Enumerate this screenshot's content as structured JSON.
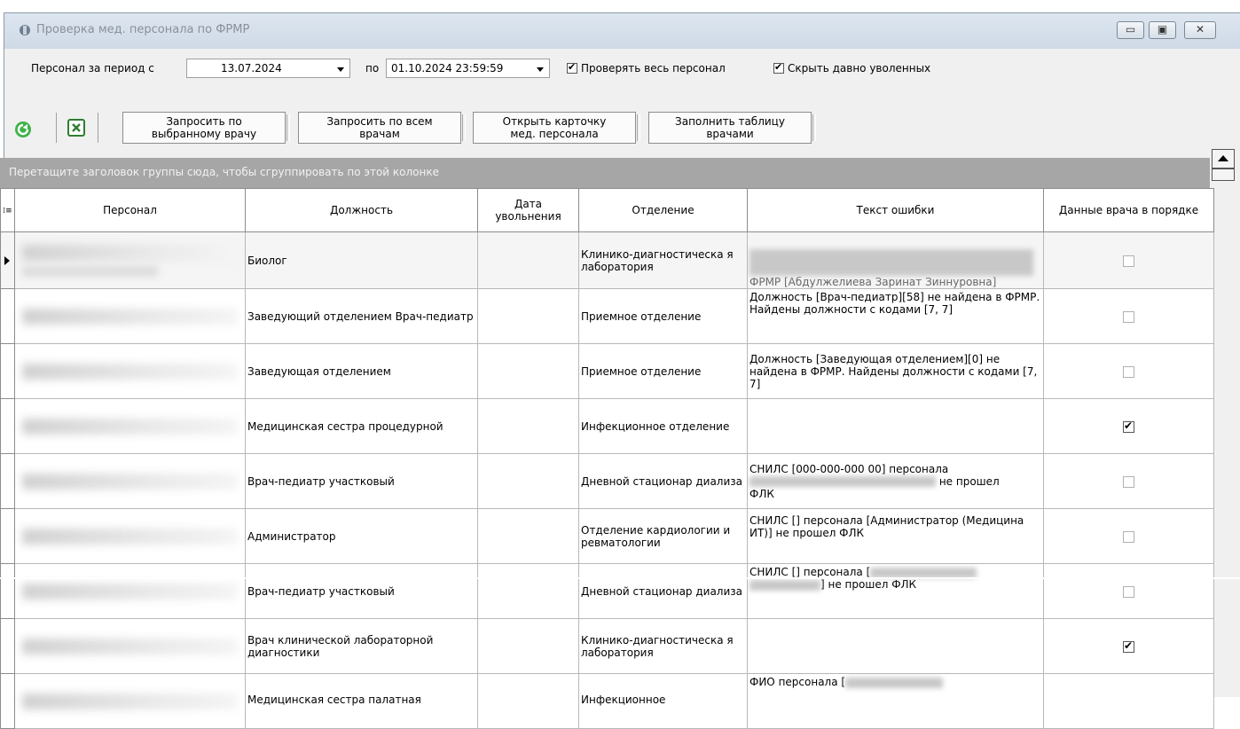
{
  "window": {
    "title": "Проверка мед. персонала по ФРМР"
  },
  "filter": {
    "period_label": "Персонал за период с",
    "date_from": "13.07.2024",
    "to_label": "по",
    "date_to": "01.10.2024 23:59:59",
    "check_all_label": "Проверять весь персонал",
    "check_all": true,
    "hide_fired_label": "Скрыть давно уволенных",
    "hide_fired": true
  },
  "toolbar": {
    "refresh_icon": "refresh-icon",
    "excel_icon": "excel-icon",
    "btn_query_selected": [
      "Запросить по",
      "выбранному врачу"
    ],
    "btn_query_all": [
      "Запросить по всем",
      "врачам"
    ],
    "btn_open_card": [
      "Открыть карточку",
      "мед. персонала"
    ],
    "btn_fill_table": [
      "Заполнить таблицу",
      "врачами"
    ]
  },
  "grid": {
    "group_hint": "Перетащите заголовок группы сюда, чтобы сгруппировать по этой колонке",
    "columns": [
      "Персонал",
      "Должность",
      "Дата увольнения",
      "Отделение",
      "Текст ошибки",
      "Данные врача в порядке"
    ],
    "rows": [
      {
        "position": "Биолог",
        "fired": "",
        "department": "Клинико-диагностическа я лаборатория",
        "error": "ФРМР [Абдулжелиева Заринат Зиннуровна]",
        "ok": false,
        "selected": true
      },
      {
        "position": "Заведующий отделением Врач-педиатр",
        "fired": "",
        "department": "Приемное отделение",
        "error": "Должность [Врач-педиатр][58] не найдена в ФРМР. Найдены должности с кодами [7, 7]",
        "ok": false
      },
      {
        "position": "Заведующая отделением",
        "fired": "",
        "department": "Приемное отделение",
        "error": "Должность [Заведующая отделением][0] не найдена в ФРМР. Найдены должности с кодами [7, 7]",
        "ok": false
      },
      {
        "position": "Медицинская сестра процедурной",
        "fired": "",
        "department": "Инфекционное отделение",
        "error": "",
        "ok": true
      },
      {
        "position": "Врач-педиатр участковый",
        "fired": "",
        "department": "Дневной стационар диализа",
        "error_a": "СНИЛС [000-000-000 00] персонала",
        "error_b": "не прошел",
        "error_c": "ФЛК",
        "ok": false
      },
      {
        "position": "Администратор",
        "fired": "",
        "department": "Отделение кардиологии и ревматологии",
        "error": "СНИЛС [] персонала [Администратор (Медицина ИТ)] не прошел ФЛК",
        "ok": false
      },
      {
        "position": "Врач-педиатр участковый",
        "fired": "",
        "department": "Дневной стационар диализа",
        "error_a": "СНИЛС [] персонала [",
        "error_b": "] не прошел ФЛК",
        "ok": false
      },
      {
        "position": "Врач клинической лабораторной диагностики",
        "fired": "",
        "department": "Клинико-диагностическа я лаборатория",
        "error": "",
        "ok": true
      },
      {
        "position": "Медицинская сестра палатная",
        "fired": "",
        "department": "Инфекционное",
        "error": "ФИО персонала [",
        "ok": false
      }
    ]
  }
}
